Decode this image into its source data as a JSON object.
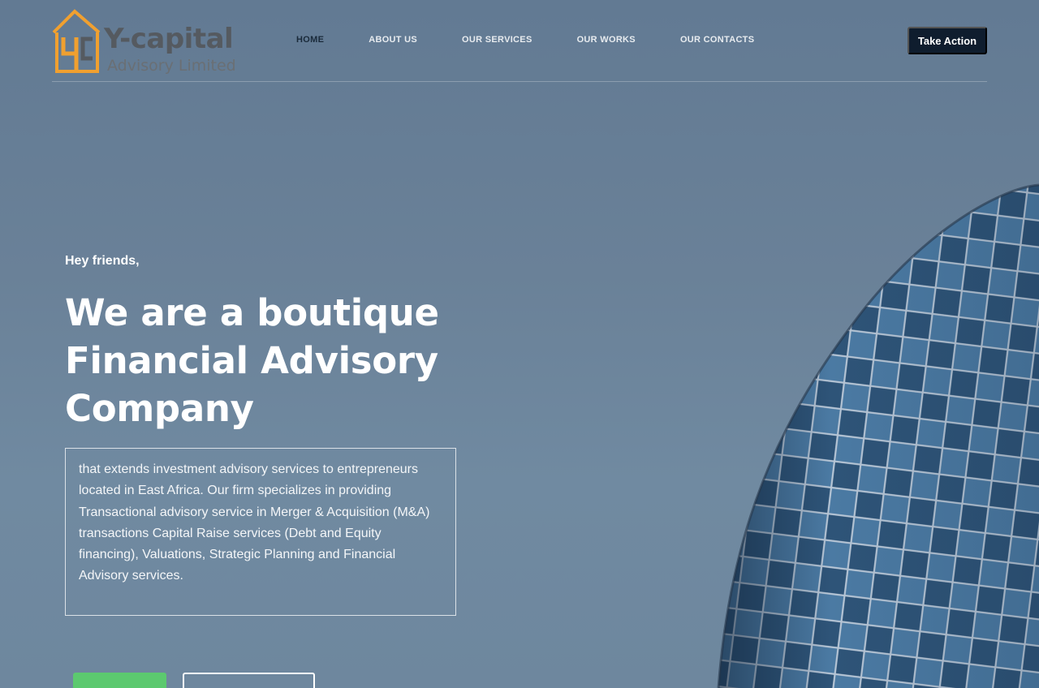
{
  "logo": {
    "name": "Y-capital",
    "subtitle": "Advisory Limited",
    "colors": {
      "orange": "#f0a030",
      "gray": "#555a60"
    }
  },
  "nav": {
    "items": [
      {
        "label": "HOME",
        "active": true
      },
      {
        "label": "ABOUT US",
        "active": false
      },
      {
        "label": "OUR SERVICES",
        "active": false
      },
      {
        "label": "OUR WORKS",
        "active": false
      },
      {
        "label": "OUR CONTACTS",
        "active": false
      }
    ],
    "cta_label": "Take Action"
  },
  "hero": {
    "greeting": "Hey friends,",
    "headline": "We are a boutique Financial Advisory Company",
    "description": "that extends investment advisory services to entrepreneurs located in East Africa. Our firm specializes in providing Transactional advisory service in Merger & Acquisition (M&A) transactions Capital Raise services (Debt and Equity financing), Valuations, Strategic Planning and Financial Advisory services."
  },
  "colors": {
    "accent_green": "#5cc96f",
    "cta_dark": "#0f1d2e",
    "active_nav": "#1a2a3a"
  }
}
